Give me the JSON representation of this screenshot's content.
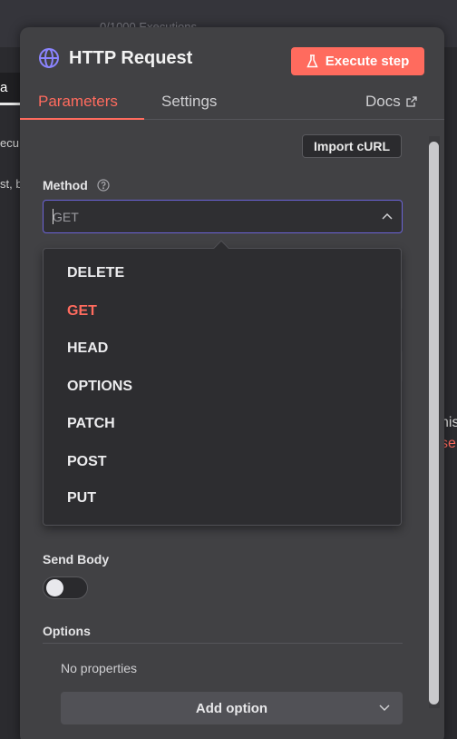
{
  "background": {
    "executions": "0/1000 Executions",
    "left_tab": "a",
    "left_text_1": "ecu",
    "left_text_2": "st, b",
    "right_text_1": "nis",
    "right_text_2": "se"
  },
  "panel": {
    "title": "HTTP Request",
    "execute_label": "Execute step",
    "tabs": [
      {
        "label": "Parameters",
        "active": true
      },
      {
        "label": "Settings",
        "active": false
      }
    ],
    "docs_label": "Docs",
    "import_curl_label": "Import cURL",
    "method": {
      "label": "Method",
      "value": "GET",
      "options": [
        "DELETE",
        "GET",
        "HEAD",
        "OPTIONS",
        "PATCH",
        "POST",
        "PUT"
      ],
      "selected": "GET"
    },
    "send_body": {
      "label": "Send Body",
      "enabled": false
    },
    "options": {
      "label": "Options",
      "empty_text": "No properties",
      "add_label": "Add option"
    }
  },
  "colors": {
    "accent": "#ff6b5e",
    "focus_border": "#6b63d6",
    "panel_bg": "#414144"
  },
  "icons": [
    "globe-icon",
    "flask-icon",
    "external-link-icon",
    "help-icon",
    "chevron-down-icon"
  ]
}
